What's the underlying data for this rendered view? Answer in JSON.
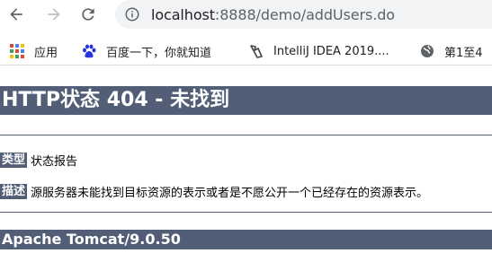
{
  "browser": {
    "url_host": "localhost",
    "url_rest": ":8888/demo/addUsers.do",
    "icons": {
      "back": "arrow-left-icon",
      "forward": "arrow-right-icon",
      "reload": "reload-icon",
      "site_info": "info-icon"
    }
  },
  "bookmarks": [
    {
      "label": "应用",
      "icon": "apps-grid-icon"
    },
    {
      "label": "百度一下，你就知道",
      "icon": "baidu-paw-icon"
    },
    {
      "label": "IntelliJ IDEA 2019....",
      "icon": "intellij-icon"
    },
    {
      "label": "第1至4",
      "icon": "globe-icon"
    }
  ],
  "page": {
    "title": "HTTP状态 404 - 未找到",
    "type_label": "类型",
    "type_value": "状态报告",
    "desc_label": "描述",
    "desc_value": "源服务器未能找到目标资源的表示或者是不愿公开一个已经存在的资源表示。",
    "footer": "Apache Tomcat/9.0.50",
    "accent_color": "#525d76"
  }
}
